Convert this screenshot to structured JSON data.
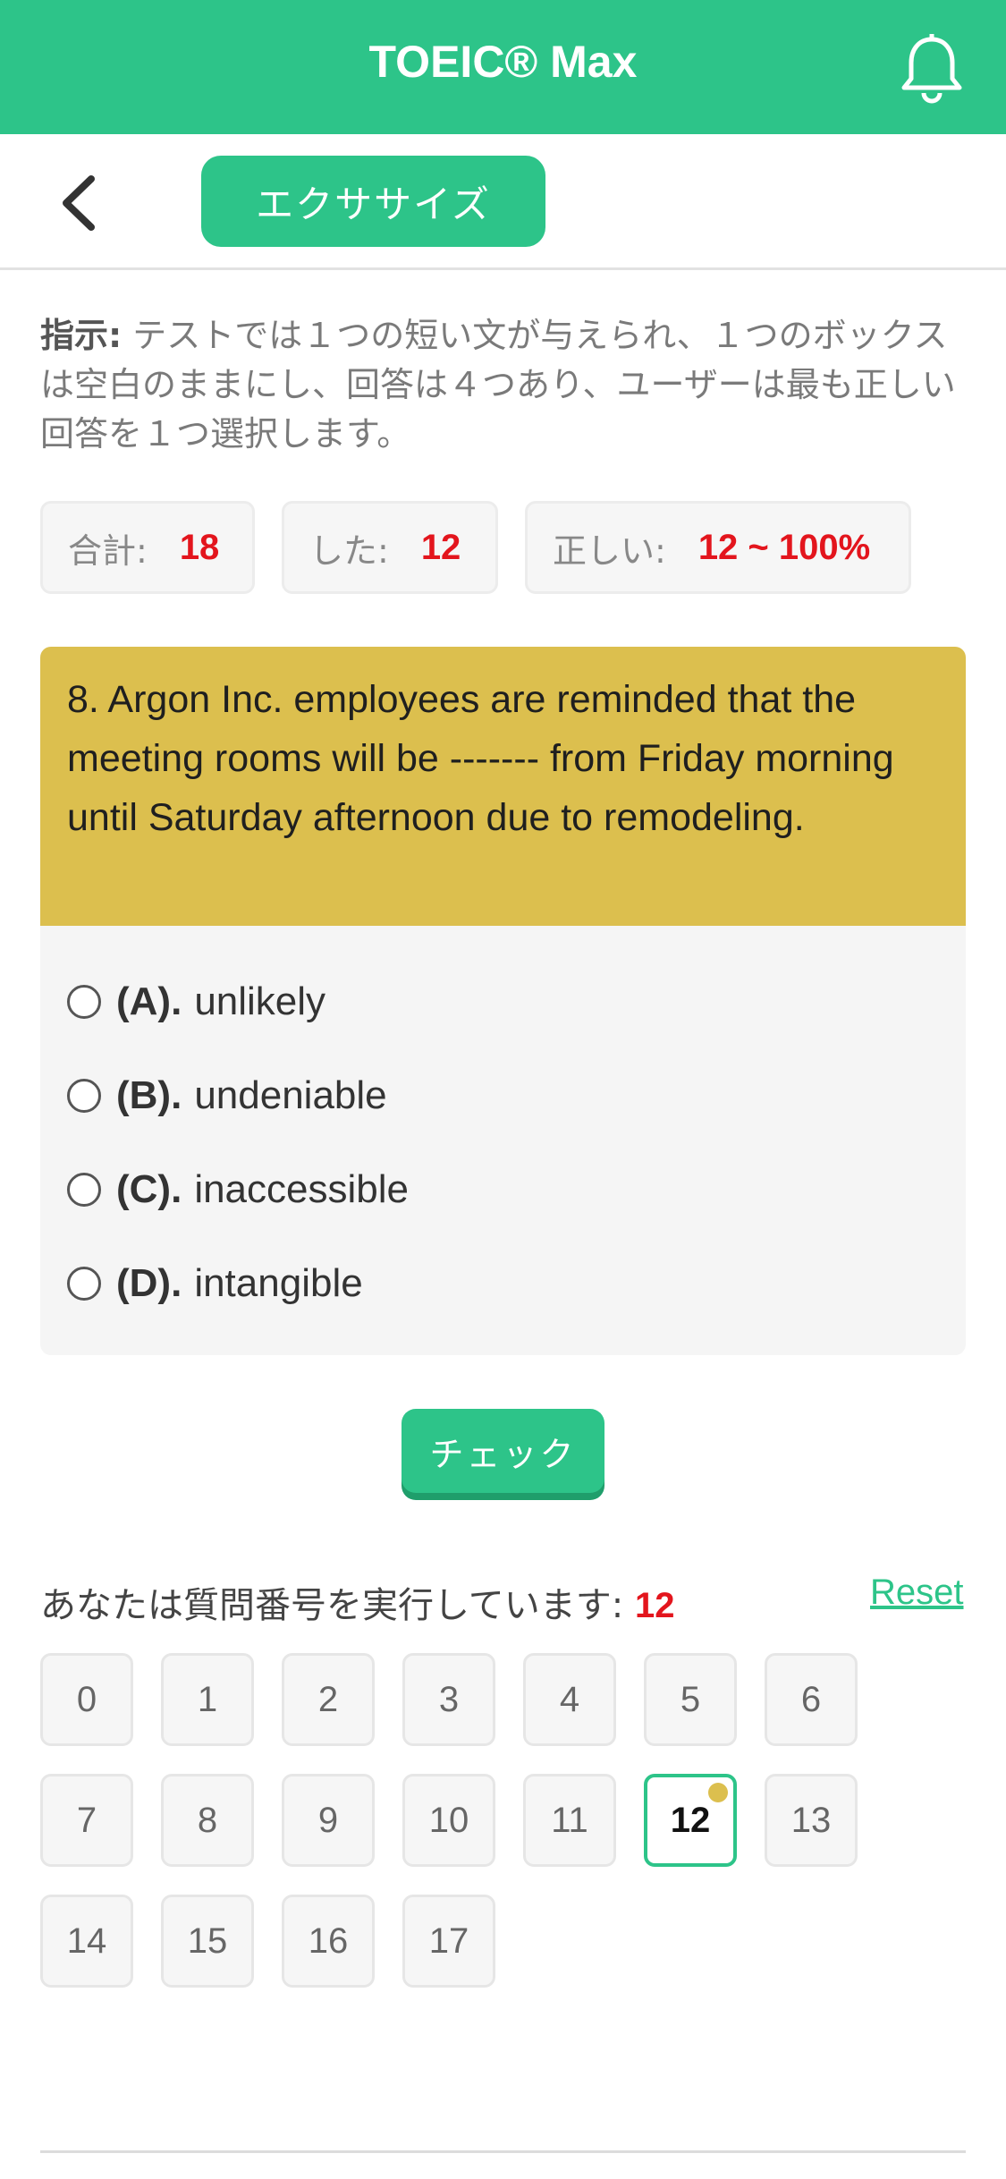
{
  "app": {
    "title": "TOEIC® Max"
  },
  "subheader": {
    "tab_label": "エクササイズ"
  },
  "instruction": {
    "label": "指示:",
    "text": " テストでは１つの短い文が与えられ、１つのボックスは空白のままにし、回答は４つあり、ユーザーは最も正しい回答を１つ選択します。"
  },
  "stats": {
    "total_label": "合計:",
    "total_value": "18",
    "done_label": "した:",
    "done_value": "12",
    "correct_label": "正しい:",
    "correct_value": "12 ~ 100%"
  },
  "question": {
    "text": "8. Argon Inc. employees are reminded that the meeting rooms will be ------- from Friday morning until Saturday afternoon due to remodeling.",
    "options": [
      {
        "letter": "(A).",
        "text": "unlikely"
      },
      {
        "letter": "(B).",
        "text": "undeniable"
      },
      {
        "letter": "(C).",
        "text": "inaccessible"
      },
      {
        "letter": "(D).",
        "text": "intangible"
      }
    ]
  },
  "check_button": {
    "label": "チェック"
  },
  "progress": {
    "running_label": "あなたは質問番号を実行しています:",
    "current": "12",
    "reset_label": "Reset",
    "numbers": [
      "0",
      "1",
      "2",
      "3",
      "4",
      "5",
      "6",
      "7",
      "8",
      "9",
      "10",
      "11",
      "12",
      "13",
      "14",
      "15",
      "16",
      "17"
    ]
  },
  "colors": {
    "brand": "#2dc489",
    "question_bg": "#dcbf4e",
    "accent_red": "#e3151d"
  }
}
